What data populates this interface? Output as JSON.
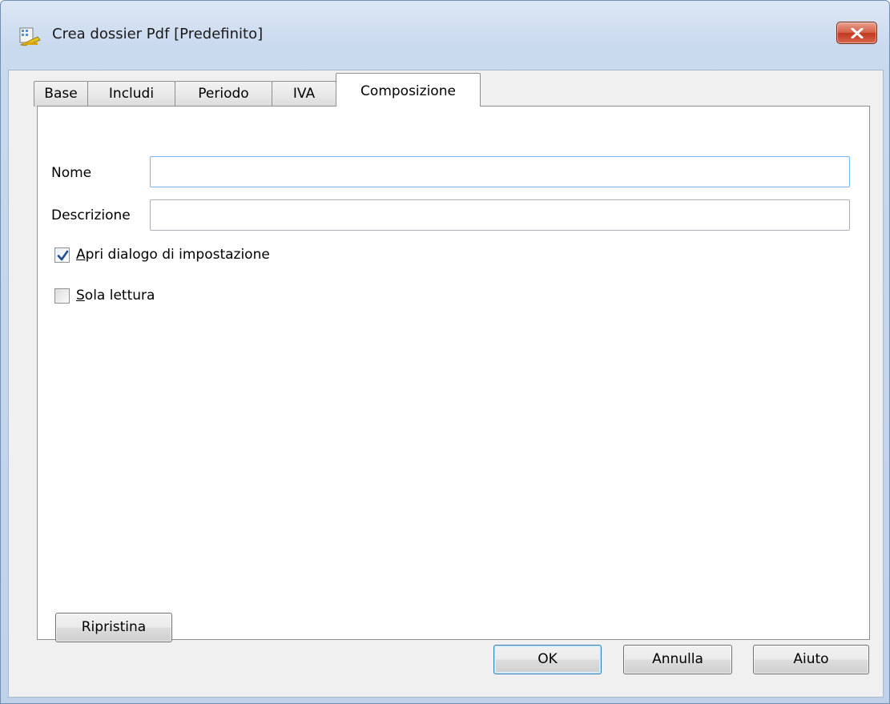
{
  "window": {
    "title": "Crea dossier Pdf [Predefinito]",
    "icon": "app-dossier-icon",
    "close_icon": "close-icon"
  },
  "tabs": [
    {
      "label": "Base",
      "active": false
    },
    {
      "label": "Includi",
      "active": false
    },
    {
      "label": "Periodo",
      "active": false
    },
    {
      "label": "IVA",
      "active": false
    },
    {
      "label": "Composizione",
      "active": true
    }
  ],
  "form": {
    "nome": {
      "label": "Nome",
      "value": ""
    },
    "descrizione": {
      "label": "Descrizione",
      "value": ""
    },
    "apri_dialogo": {
      "label_prefix": "A",
      "label_rest": "pri dialogo di impostazione",
      "checked": true
    },
    "sola_lettura": {
      "label_prefix": "S",
      "label_rest": "ola lettura",
      "checked": false
    },
    "ripristina_label": "Ripristina"
  },
  "buttons": {
    "ok": "OK",
    "annulla": "Annulla",
    "aiuto": "Aiuto"
  },
  "colors": {
    "accent_focus": "#7eb4ea",
    "close_red": "#c0391f",
    "check_blue": "#1f4d9a"
  }
}
